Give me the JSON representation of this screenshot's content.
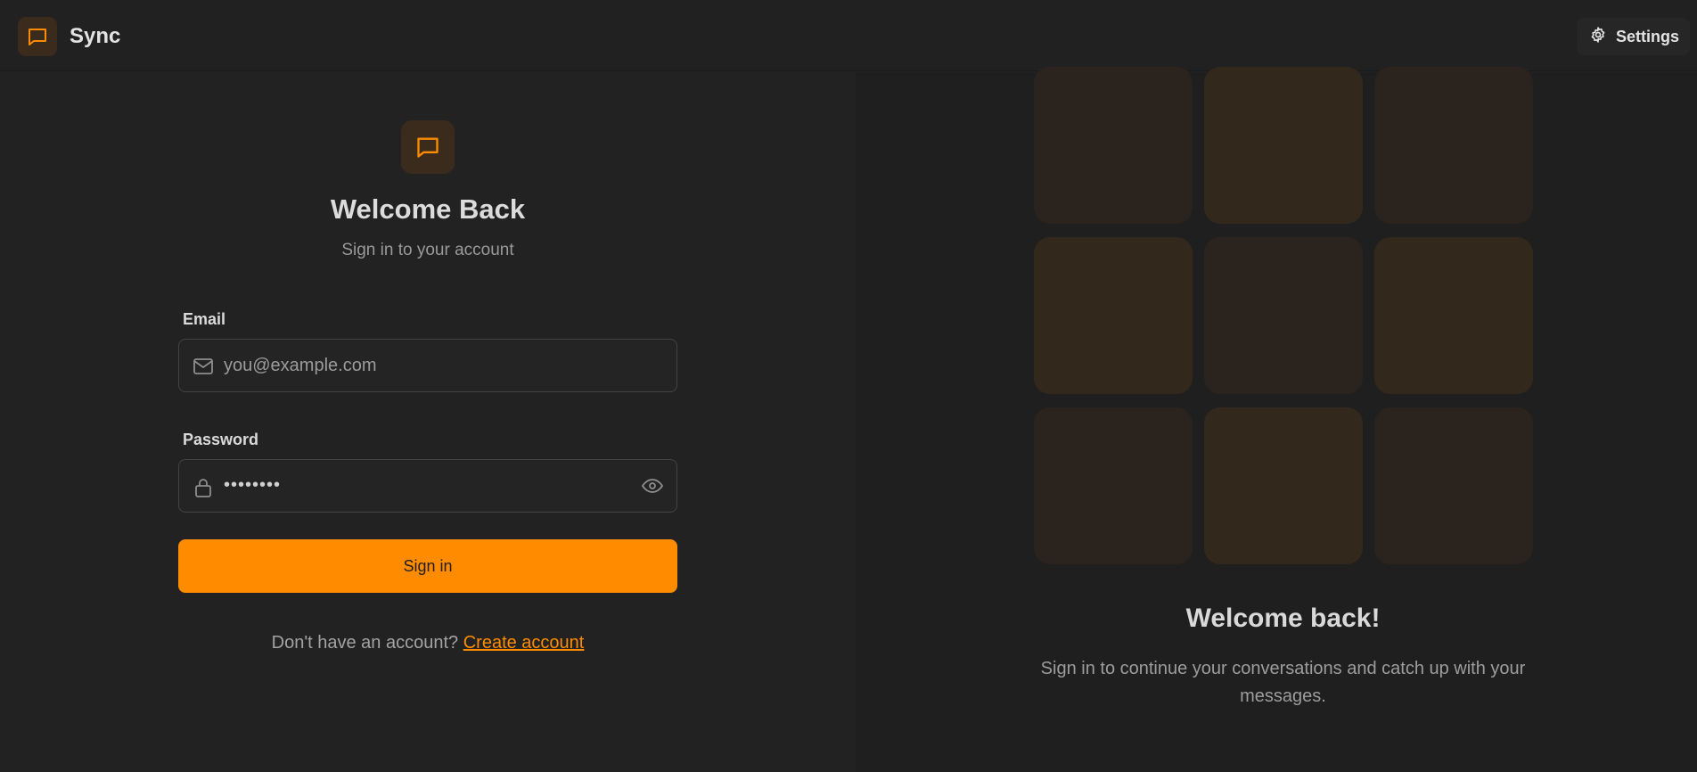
{
  "header": {
    "app_name": "Sync",
    "settings_label": "Settings",
    "accent_color": "#ff8c00"
  },
  "login": {
    "logo_icon": "chat-bubble-icon",
    "title": "Welcome Back",
    "subtitle": "Sign in to your account",
    "email": {
      "label": "Email",
      "placeholder": "you@example.com",
      "value": "",
      "icon": "mail-icon"
    },
    "password": {
      "label": "Password",
      "masked_value": "••••••••",
      "icon": "lock-icon",
      "toggle_icon": "eye-icon"
    },
    "signin_label": "Sign in",
    "signup_prompt": "Don't have an account?",
    "signup_link": "Create account"
  },
  "promo": {
    "title": "Welcome back!",
    "text": "Sign in to continue your conversations and catch up with your messages."
  }
}
